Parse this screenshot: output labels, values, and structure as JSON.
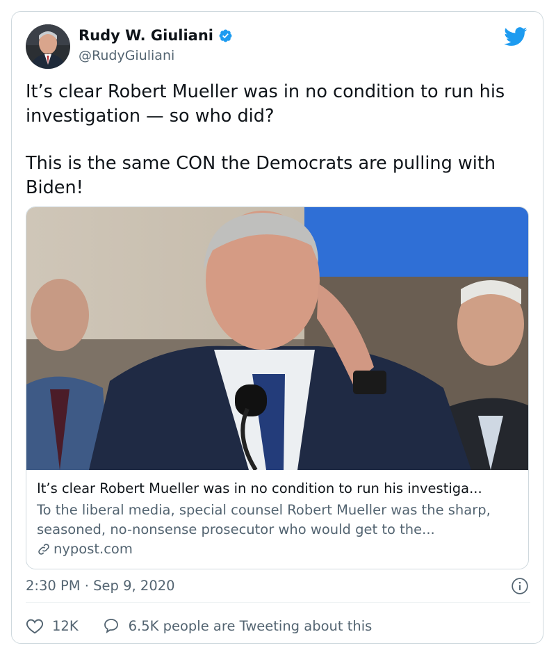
{
  "tweet": {
    "author_name": "Rudy W. Giuliani",
    "handle": "@RudyGiuliani",
    "verified": true,
    "paragraphs": [
      "It’s clear Robert Mueller was in no condition to run his investigation — so who did?",
      "This is the same CON the Democrats are pulling with Biden!"
    ],
    "link_card": {
      "title": "It’s clear Robert Mueller was in no condition to run his investiga...",
      "description": "To the liberal media, special counsel Robert Mueller was the sharp, seasoned, no-nonsense prosecutor who would get to the...",
      "domain": "nypost.com"
    },
    "timestamp": "2:30 PM · Sep 9, 2020",
    "likes": "12K",
    "tweeting_about": "6.5K people are Tweeting about this"
  },
  "colors": {
    "brand": "#1d9bf0",
    "text_primary": "#0f1419",
    "text_secondary": "#536471",
    "border": "#cfd9de"
  },
  "icons": {
    "logo": "twitter-bird-icon",
    "verified": "verified-badge-icon",
    "info": "info-icon",
    "link": "link-icon",
    "like": "heart-icon",
    "reply": "speech-bubble-icon"
  }
}
